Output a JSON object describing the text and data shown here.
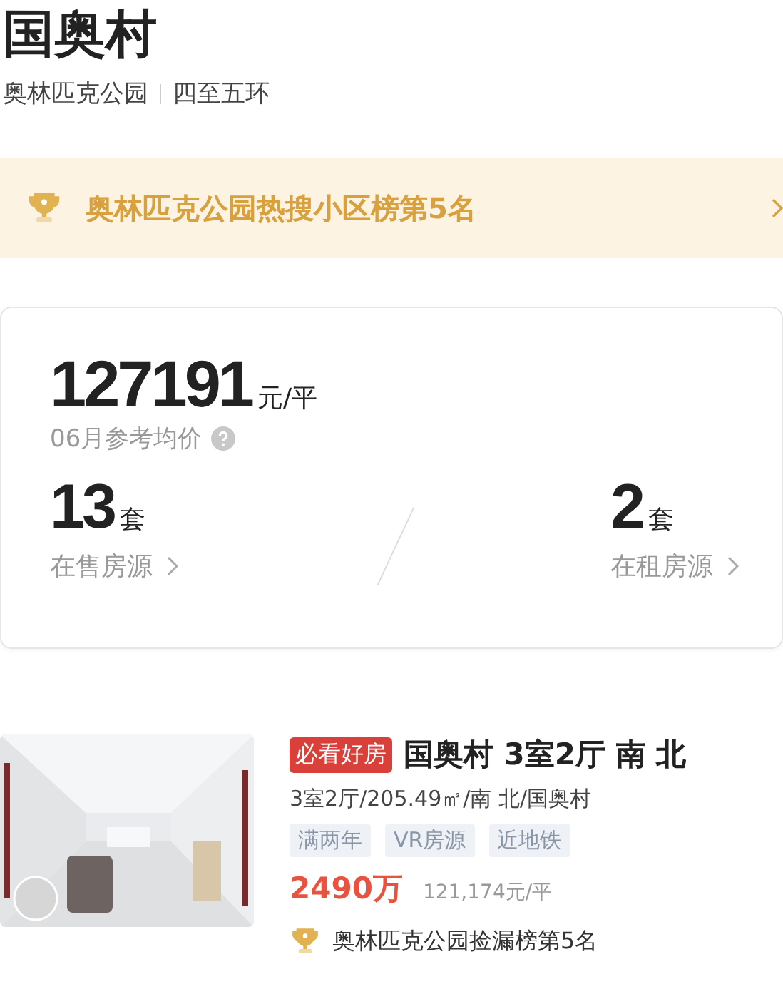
{
  "title": "国奥村",
  "location": {
    "area": "奥林匹克公园",
    "ring": "四至五环"
  },
  "rank_banner": {
    "text": "奥林匹克公园热搜小区榜第5名"
  },
  "price_card": {
    "price": "127191",
    "unit": "元/平",
    "caption": "06月参考均价",
    "stats": [
      {
        "count": "13",
        "unit": "套",
        "label": "在售房源"
      },
      {
        "count": "2",
        "unit": "套",
        "label": "在租房源"
      }
    ]
  },
  "listings": [
    {
      "badge": "必看好房",
      "title": "国奥村 3室2厅 南 北",
      "details": "3室2厅/205.49㎡/南 北/国奥村",
      "tags": [
        "满两年",
        "VR房源",
        "近地铁"
      ],
      "total_price": "2490万",
      "unit_price": "121,174元/平",
      "rank": "奥林匹克公园捡漏榜第5名"
    }
  ]
}
